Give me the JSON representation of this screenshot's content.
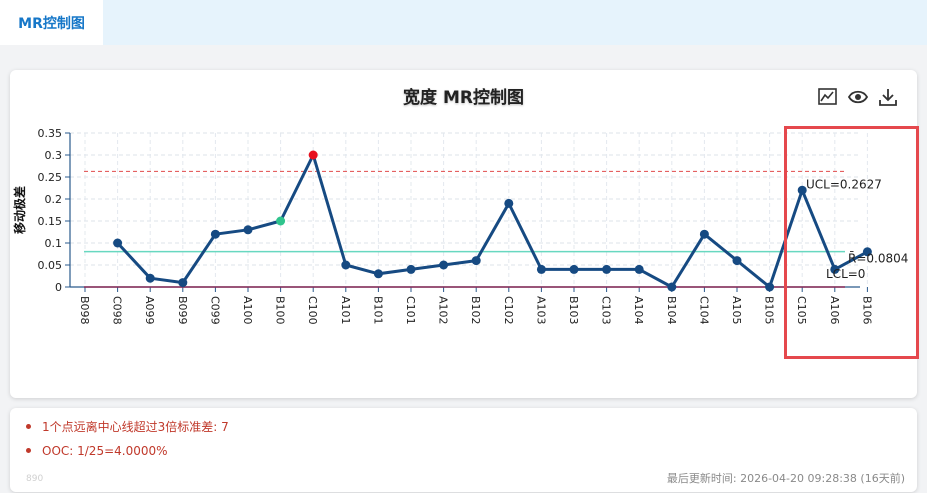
{
  "tab": {
    "label": "MR控制图"
  },
  "chart": {
    "title": "宽度 MR控制图",
    "toolbar": [
      "line-chart-icon",
      "eye-icon",
      "download-icon"
    ]
  },
  "chart_data": {
    "type": "line",
    "ylabel": "移动极差",
    "xlabel": "",
    "ylim": [
      0,
      0.35
    ],
    "yticks": [
      "0",
      "0.05",
      "0.1",
      "0.15",
      "0.2",
      "0.25",
      "0.3",
      "0.35"
    ],
    "categories": [
      "B098",
      "C098",
      "A099",
      "B099",
      "C099",
      "A100",
      "B100",
      "C100",
      "A101",
      "B101",
      "C101",
      "A102",
      "B102",
      "C102",
      "A103",
      "B103",
      "C103",
      "A104",
      "B104",
      "C104",
      "A105",
      "B105",
      "C105",
      "A106",
      "B106"
    ],
    "series": [
      {
        "values": [
          null,
          0.1,
          0.02,
          0.01,
          0.12,
          0.13,
          0.15,
          0.3,
          0.05,
          0.03,
          0.04,
          0.05,
          0.06,
          0.19,
          0.04,
          0.04,
          0.04,
          0.04,
          0,
          0.12,
          0.06,
          0,
          0.22,
          0.04,
          0.08
        ]
      }
    ],
    "highlight_points": [
      {
        "category": "C100",
        "color": "#e8101e"
      },
      {
        "category": "B100",
        "color": "#2fc48d"
      }
    ],
    "control_lines": [
      {
        "label": "UCL=0.2627",
        "value": 0.2627,
        "color": "#e14b4b",
        "style": "dashed"
      },
      {
        "label": "R̄=0.0804",
        "value": 0.0804,
        "color": "#68d8c0",
        "style": "solid"
      },
      {
        "label": "LCL=0",
        "value": 0,
        "color": "#8b2b56",
        "style": "solid"
      }
    ],
    "grid": true,
    "series_color": "#164a82"
  },
  "notes": [
    "1个点远离中心线超过3倍标准差: 7",
    "OOC: 1/25=4.0000%"
  ],
  "footer": {
    "faint_text": "890",
    "updated": "最后更新时间: 2026-04-20 09:28:38 (16天前)"
  },
  "colors": {
    "accent": "#1677c8",
    "highlight_box": "#e5484d"
  }
}
